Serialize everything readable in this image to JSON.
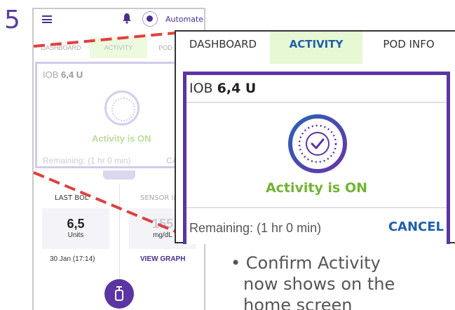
{
  "step": "5",
  "phone": {
    "header": {
      "status": "Automated"
    },
    "tabs": [
      "DASHBOARD",
      "ACTIVITY",
      "POD INFO"
    ],
    "tabs_cut": [
      "DASHBOARD",
      "ACTIVITY",
      "POD"
    ],
    "card": {
      "iob_label": "IOB",
      "iob_value": "6,4 U",
      "status": "Activity is ON",
      "remaining": "Remaining: (1 hr 0 min)",
      "cancel": "CANCEL",
      "cancel_cut": "CA"
    },
    "last_bolus": {
      "title": "LAST BOLUS",
      "title_cut": "LAST BOL",
      "value": "6,5",
      "unit": "Units",
      "date": "30 Jan (17:14)"
    },
    "sensor": {
      "title": "SENSOR IN",
      "value": "155",
      "unit": "mg/dL",
      "view_graph": "VIEW GRAPH"
    }
  },
  "zoom": {
    "tabs": [
      "DASHBOARD",
      "ACTIVITY",
      "POD INFO"
    ],
    "iob_label": "IOB",
    "iob_value": "6,4 U",
    "status": "Activity is ON",
    "remaining": "Remaining: (1 hr 0 min)",
    "cancel": "CANCEL"
  },
  "caption": {
    "line1": "Confirm Activity",
    "line2": "now shows on the",
    "line3": "home screen"
  },
  "colors": {
    "brand_purple": "#5b35a2",
    "activity_green": "#72b334",
    "link_blue": "#1f5fa8",
    "callout_red": "#e04040"
  },
  "icons": [
    "menu-icon",
    "bell-icon",
    "automated-mode-icon",
    "activity-check-icon",
    "bolus-icon"
  ]
}
